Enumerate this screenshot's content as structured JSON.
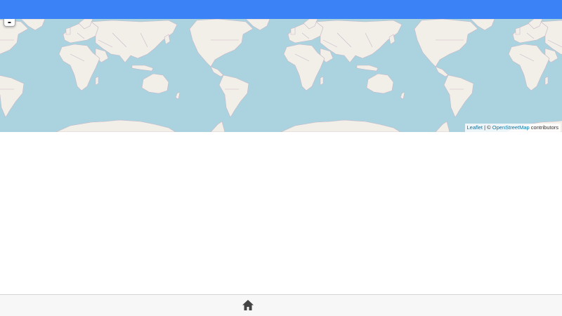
{
  "header": {
    "color": "#3b82f6"
  },
  "map": {
    "ocean_color": "#aad3df",
    "land_color": "#f2efe9",
    "border_color": "#c9b8c8",
    "zoom_out_label": "-",
    "attribution": {
      "leaflet_link": "Leaflet",
      "separator": " | © ",
      "osm_link": "OpenStreetMap",
      "suffix": " contributors"
    }
  },
  "bottom_nav": {
    "background": "#f7f7f7",
    "home_icon": "home-icon",
    "icon_color": "#444444"
  }
}
